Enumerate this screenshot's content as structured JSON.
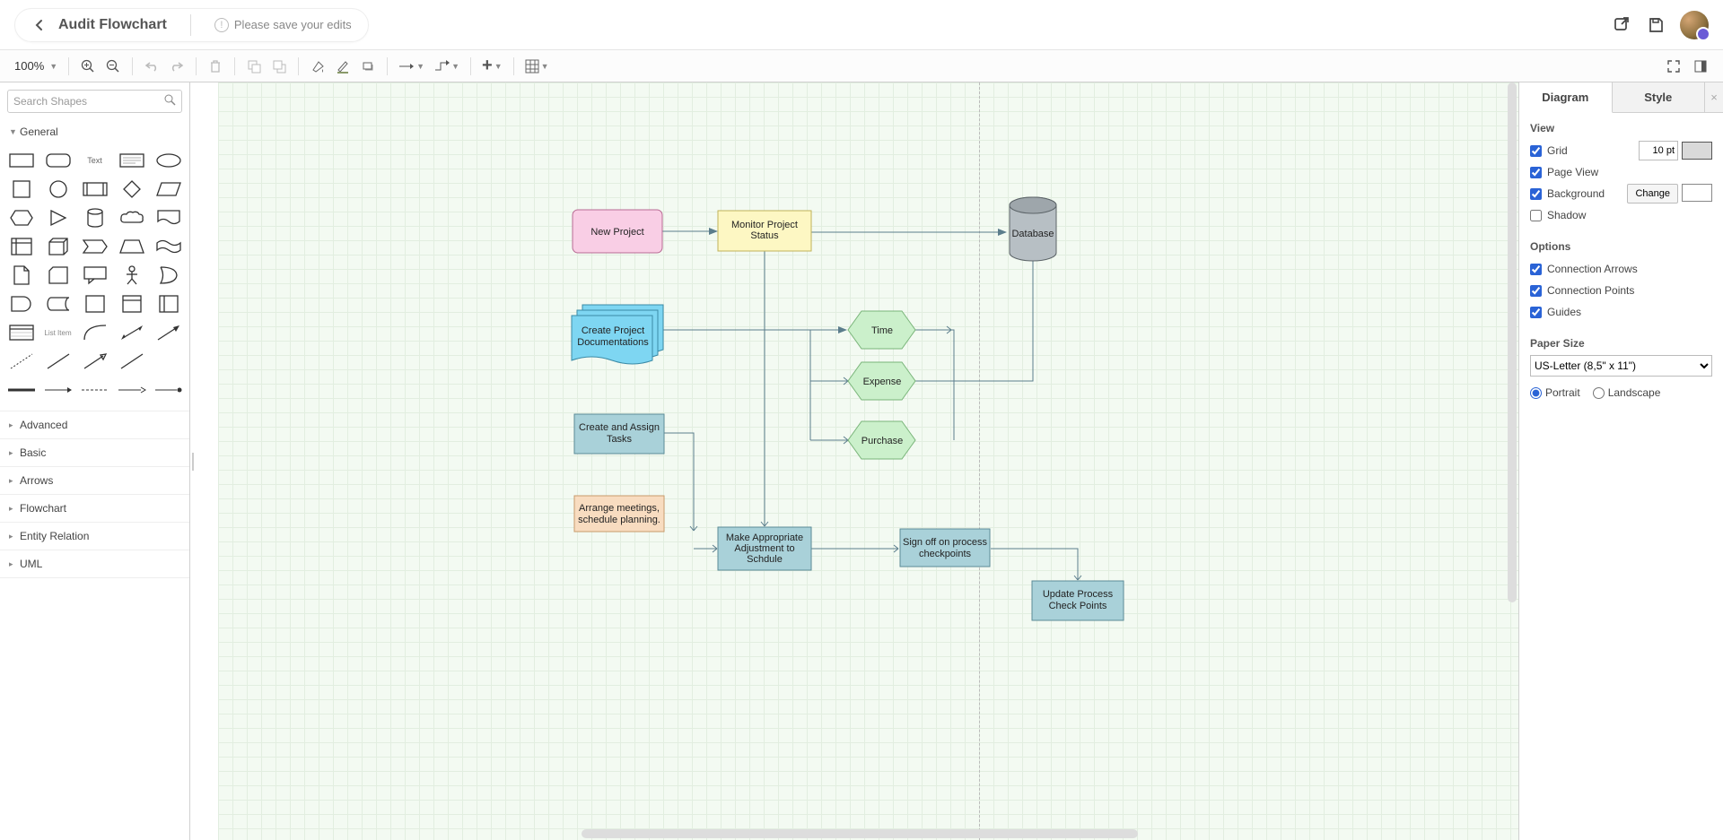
{
  "header": {
    "title": "Audit Flowchart",
    "hint": "Please save your edits"
  },
  "toolbar": {
    "zoom": "100%"
  },
  "leftPanel": {
    "searchPlaceholder": "Search Shapes",
    "categories": {
      "general": "General",
      "advanced": "Advanced",
      "basic": "Basic",
      "arrows": "Arrows",
      "flowchart": "Flowchart",
      "entity": "Entity Relation",
      "uml": "UML"
    }
  },
  "rightPanel": {
    "tabs": {
      "diagram": "Diagram",
      "style": "Style"
    },
    "view": {
      "title": "View",
      "grid": "Grid",
      "gridSize": "10 pt",
      "pageView": "Page View",
      "background": "Background",
      "change": "Change",
      "shadow": "Shadow"
    },
    "options": {
      "title": "Options",
      "connArrows": "Connection Arrows",
      "connPoints": "Connection Points",
      "guides": "Guides"
    },
    "paper": {
      "title": "Paper Size",
      "size": "US-Letter (8,5\" x 11\")",
      "portrait": "Portrait",
      "landscape": "Landscape"
    }
  },
  "nodes": {
    "newProject": "New Project",
    "monitor": "Monitor Project Status",
    "database": "Database",
    "createDocs1": "Create Project",
    "createDocs2": "Documentations",
    "time": "Time",
    "expense": "Expense",
    "purchase": "Purchase",
    "createTasks1": "Create and Assign",
    "createTasks2": "Tasks",
    "arrange1": "Arrange meetings,",
    "arrange2": "schedule planning.",
    "adjust1": "Make Appropriate",
    "adjust2": "Adjustment to",
    "adjust3": "Schdule",
    "signoff1": "Sign off on process",
    "signoff2": "checkpoints",
    "update1": "Update Process",
    "update2": "Check Points"
  }
}
